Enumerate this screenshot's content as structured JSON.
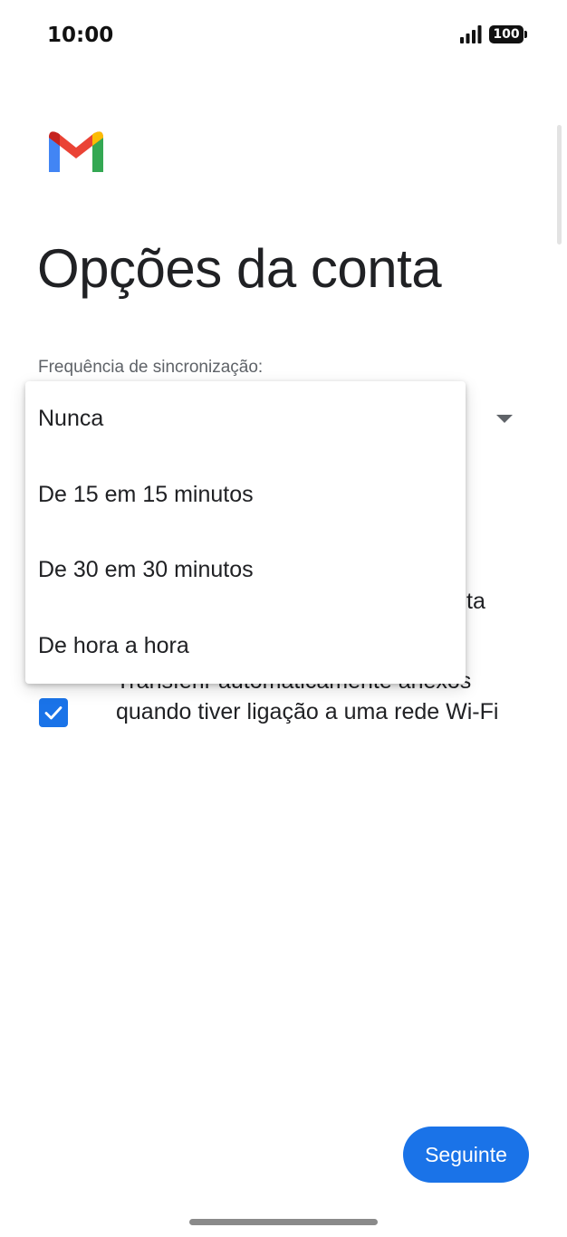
{
  "status_bar": {
    "time": "10:00",
    "battery": "100"
  },
  "logo": {
    "icon": "gmail-logo-icon",
    "colors": [
      "#4285F4",
      "#EA4335",
      "#FBBC04",
      "#34A853",
      "#C5221F"
    ]
  },
  "header": {
    "title": "Opções da conta"
  },
  "sync": {
    "label": "Frequência de sincronização:",
    "menu_items": [
      "Nunca",
      "De 15 em 15 minutos",
      "De 30 em 30 minutos",
      "De hora a hora"
    ]
  },
  "options": {
    "partial_text": "ta",
    "attachments_label": "Transferir automaticamente anexos quando tiver ligação a uma rede Wi-Fi",
    "attachments_checked": true
  },
  "footer": {
    "next_label": "Seguinte"
  },
  "colors": {
    "accent": "#1a73e8",
    "text_primary": "#202124",
    "text_secondary": "#5f6368"
  }
}
